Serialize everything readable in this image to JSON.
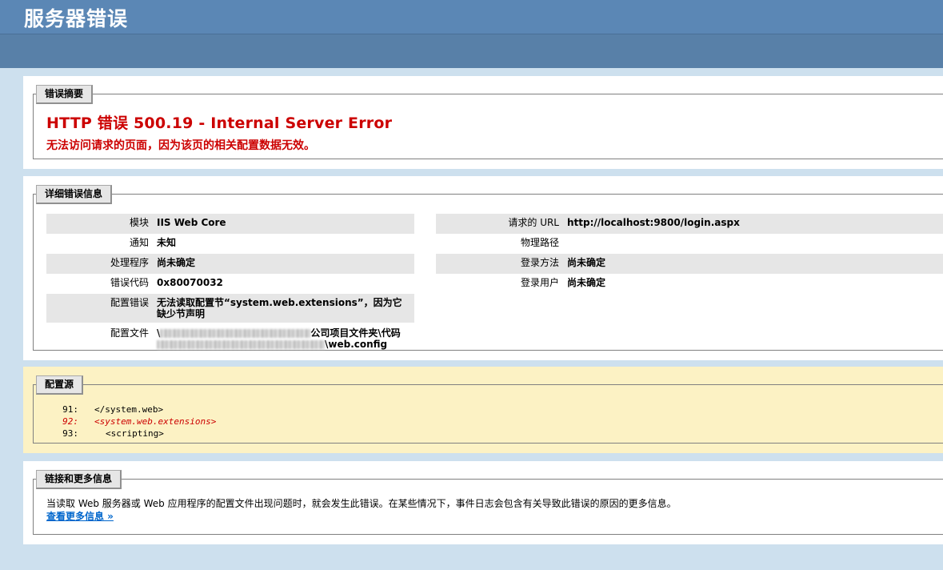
{
  "page": {
    "title": "服务器错误"
  },
  "summary": {
    "legend": "错误摘要",
    "heading": "HTTP 错误 500.19 - Internal Server Error",
    "message": "无法访问请求的页面，因为该页的相关配置数据无效。"
  },
  "details": {
    "legend": "详细错误信息",
    "left_rows": [
      {
        "label": "模块",
        "value": "IIS Web Core"
      },
      {
        "label": "通知",
        "value": "未知"
      },
      {
        "label": "处理程序",
        "value": "尚未确定"
      },
      {
        "label": "错误代码",
        "value": "0x80070032"
      },
      {
        "label": "配置错误",
        "value": "无法读取配置节“system.web.extensions”，因为它缺少节声明"
      },
      {
        "label": "配置文件",
        "value_part1": "\\",
        "value_part2": "公司项目文件夹\\代码",
        "value_part3": "\\web.config"
      }
    ],
    "right_rows": [
      {
        "label": "请求的 URL",
        "value": "http://localhost:9800/login.aspx"
      },
      {
        "label": "物理路径",
        "value": ""
      },
      {
        "label": "登录方法",
        "value": "尚未确定"
      },
      {
        "label": "登录用户",
        "value": "尚未确定"
      }
    ]
  },
  "config_source": {
    "legend": "配置源",
    "lines": [
      {
        "num": "91:",
        "code": "</system.web>"
      },
      {
        "num": "92:",
        "code": "<system.web.extensions>"
      },
      {
        "num": "93:",
        "code": "<scripting>"
      }
    ]
  },
  "more_info": {
    "legend": "链接和更多信息",
    "text": "当读取 Web 服务器或 Web 应用程序的配置文件出现问题时，就会发生此错误。在某些情况下，事件日志会包含有关导致此错误的原因的更多信息。",
    "link": "查看更多信息 »"
  }
}
